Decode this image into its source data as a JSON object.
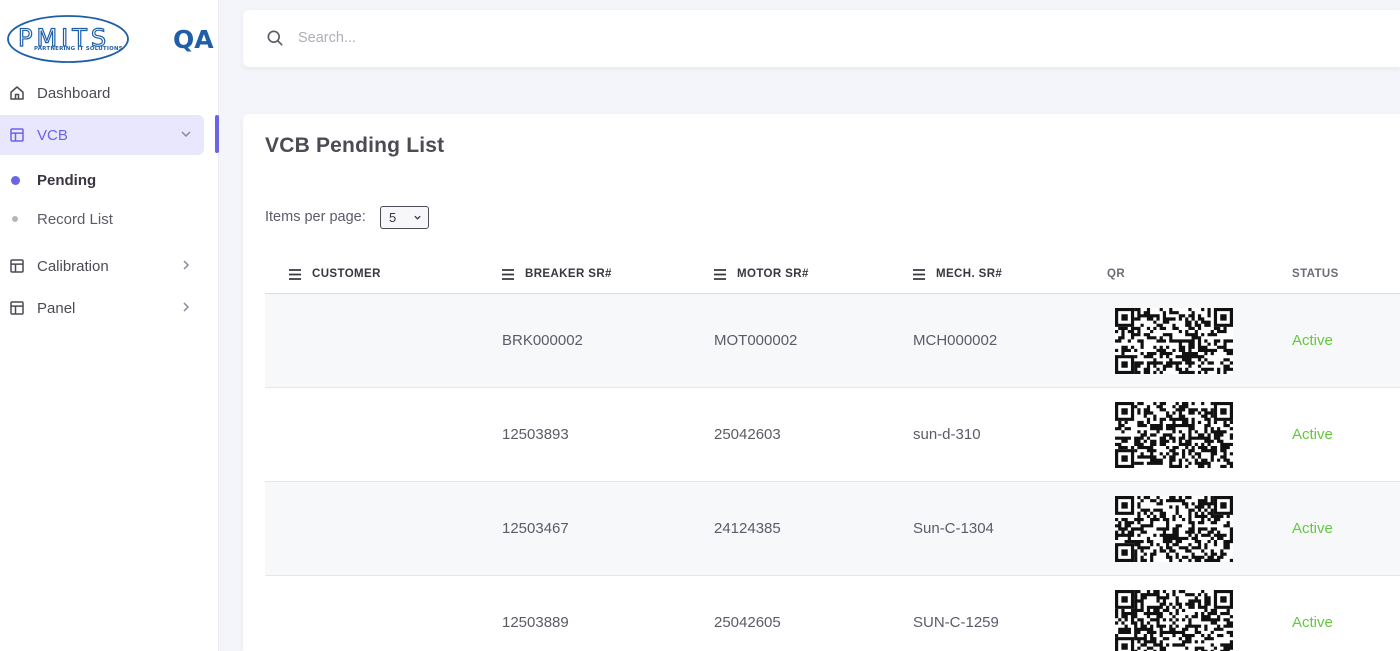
{
  "brand": {
    "logo_text": "PMITS",
    "logo_tagline": "PARTNERING IT SOLUTIONS",
    "env_label": "QA",
    "brand_color": "#1f5fa8"
  },
  "sidebar": {
    "items": [
      {
        "label": "Dashboard",
        "icon": "home-icon"
      },
      {
        "label": "VCB",
        "icon": "layout-icon",
        "expanded": true
      },
      {
        "label": "Calibration",
        "icon": "layout-icon"
      },
      {
        "label": "Panel",
        "icon": "layout-icon"
      }
    ],
    "vcb_children": [
      {
        "label": "Pending",
        "current": true
      },
      {
        "label": "Record List",
        "current": false
      }
    ],
    "accent": "#6b64e6"
  },
  "header": {
    "search_placeholder": "Search...",
    "search_value": ""
  },
  "main": {
    "title": "VCB Pending List",
    "items_per_page_label": "Items per page:",
    "items_per_page_value": "5",
    "columns": [
      "CUSTOMER",
      "BREAKER SR#",
      "MOTOR SR#",
      "MECH. SR#",
      "QR",
      "STATUS"
    ],
    "rows": [
      {
        "customer": "",
        "breaker": "BRK000002",
        "motor": "MOT000002",
        "mech": "MCH000002",
        "status": "Active"
      },
      {
        "customer": "",
        "breaker": "12503893",
        "motor": "25042603",
        "mech": "sun-d-310",
        "status": "Active"
      },
      {
        "customer": "",
        "breaker": "12503467",
        "motor": "24124385",
        "mech": "Sun-C-1304",
        "status": "Active"
      },
      {
        "customer": "",
        "breaker": "12503889",
        "motor": "25042605",
        "mech": "SUN-C-1259",
        "status": "Active"
      }
    ],
    "status_color": "#63c93c"
  }
}
